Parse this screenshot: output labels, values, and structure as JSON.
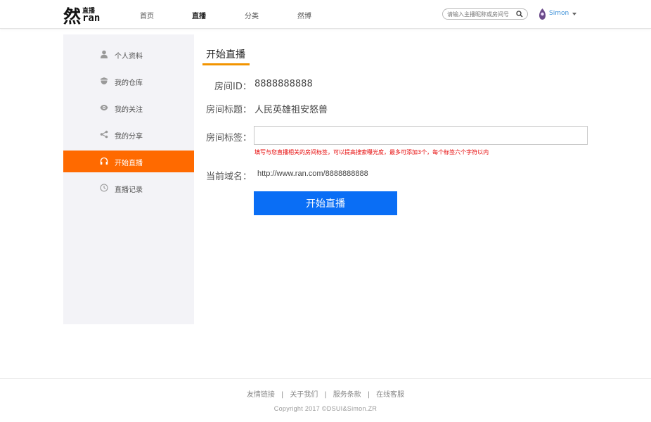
{
  "header": {
    "logo": {
      "big": "然",
      "small": "直播",
      "ran": "ran"
    },
    "nav": [
      "首页",
      "直播",
      "分类",
      "然博"
    ],
    "active_nav": "直播",
    "search": {
      "placeholder": "请输入主播昵称或房间号",
      "value": ""
    },
    "user": {
      "name": "Simon"
    }
  },
  "sidebar": {
    "items": [
      {
        "label": "个人资料",
        "icon": "user-icon"
      },
      {
        "label": "我的仓库",
        "icon": "warehouse-icon"
      },
      {
        "label": "我的关注",
        "icon": "eye-icon"
      },
      {
        "label": "我的分享",
        "icon": "share-icon"
      },
      {
        "label": "开始直播",
        "icon": "headphones-icon"
      },
      {
        "label": "直播记录",
        "icon": "clock-icon"
      }
    ],
    "active": "开始直播"
  },
  "main": {
    "title": "开始直播",
    "room_id_label": "房间ID：",
    "room_id": "8888888888",
    "room_title_label": "房间标题：",
    "room_title": "人民英雄祖安怒兽",
    "room_tags_label": "房间标签：",
    "room_tags_value": "",
    "tags_hint": "填写与您直播相关的房间标签，可以提高搜索曝光度，最多可添加3个，每个标签六个字符以内",
    "domain_label": "当前域名：",
    "domain": "http://www.ran.com/8888888888",
    "start_button": "开始直播"
  },
  "footer": {
    "links": [
      "友情链接",
      "关于我们",
      "服务条款",
      "在线客服"
    ],
    "separator": "|",
    "copyright": "Copyright 2017 ©DSUI&Simon.ZR"
  },
  "colors": {
    "accent_orange": "#ff6a00",
    "underline_orange": "#f29400",
    "button_blue": "#0a6ef5",
    "hint_red": "#e60000",
    "user_blue": "#3a8fd8"
  }
}
